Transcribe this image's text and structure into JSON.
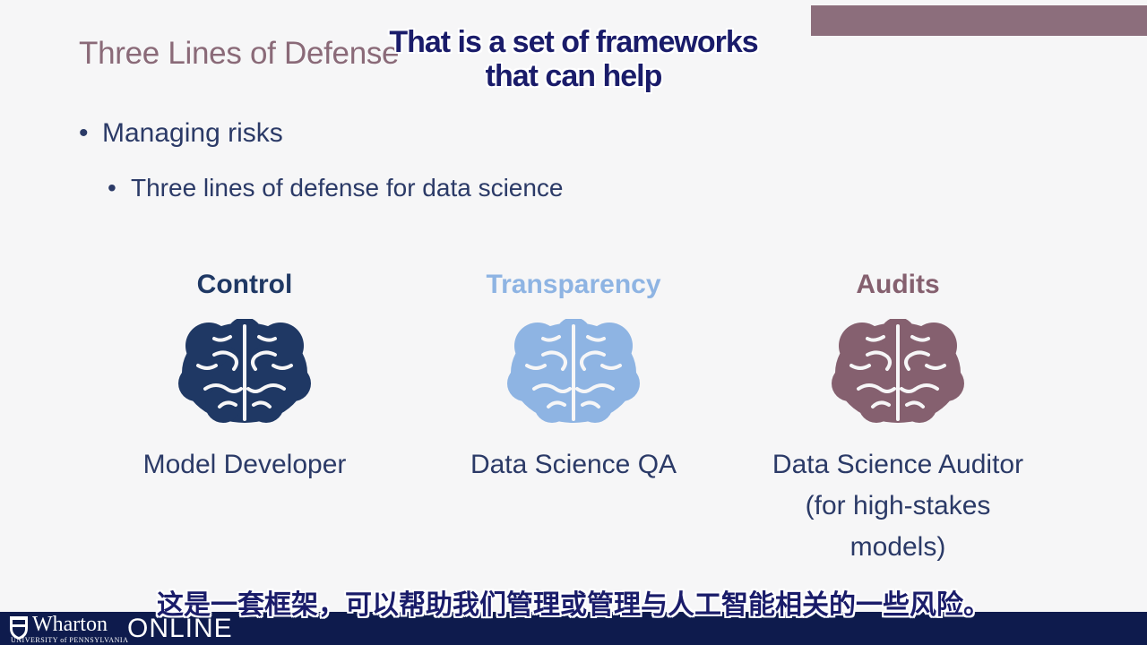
{
  "slide": {
    "title": "Three Lines of Defense",
    "bullets": [
      {
        "text": "Managing risks"
      },
      {
        "text": "Three lines of defense for data science"
      }
    ],
    "columns": [
      {
        "heading": "Control",
        "role_lines": [
          "Model Developer"
        ],
        "color": "#1f3864",
        "icon": "brain-icon"
      },
      {
        "heading": "Transparency",
        "role_lines": [
          "Data Science QA"
        ],
        "color": "#8eb4e3",
        "icon": "brain-icon"
      },
      {
        "heading": "Audits",
        "role_lines": [
          "Data Science Auditor",
          "(for high-stakes models)"
        ],
        "color": "#85606f",
        "icon": "brain-icon"
      }
    ]
  },
  "captions": {
    "english": "That is a set of frameworks that can help",
    "chinese": "这是一套框架，可以帮助我们管理或管理与人工智能相关的一些风险。"
  },
  "footer": {
    "logo_name": "Wharton",
    "logo_sub": "UNIVERSITY of PENNSYLVANIA",
    "logo_online": "ONLINE",
    "background": "#0e1b4d"
  },
  "colors": {
    "title": "#8a6a78",
    "body_text": "#2b3a67",
    "caption": "#1a1c6a",
    "top_bar": "#8c6e7c"
  }
}
